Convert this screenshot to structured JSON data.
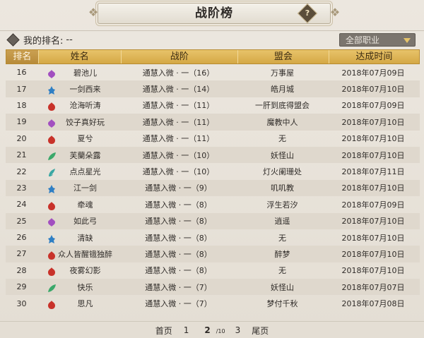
{
  "title": "战阶榜",
  "help_icon_glyph": "?",
  "my_rank": {
    "label": "我的排名:",
    "value": "--"
  },
  "job_filter": {
    "selected": "全部职业"
  },
  "table": {
    "headers": [
      "排名",
      "姓名",
      "战阶",
      "盟会",
      "达成时间"
    ],
    "rows": [
      {
        "rank": "16",
        "name": "碧池儿",
        "icon": "purple-lotus-icon",
        "tier": "通慧入微 · 一（16）",
        "guild": "万事屋",
        "date": "2018年07月09日"
      },
      {
        "rank": "17",
        "name": "一剑西来",
        "icon": "blue-lamp-icon",
        "tier": "通慧入微 · 一（14）",
        "guild": "皓月城",
        "date": "2018年07月10日"
      },
      {
        "rank": "18",
        "name": "沧海听涛",
        "icon": "red-flame-icon",
        "tier": "通慧入微 · 一（11）",
        "guild": "一肝到底得盟会",
        "date": "2018年07月09日"
      },
      {
        "rank": "19",
        "name": "饺子真好玩",
        "icon": "purple-lotus-icon",
        "tier": "通慧入微 · 一（11）",
        "guild": "魔教中人",
        "date": "2018年07月10日"
      },
      {
        "rank": "20",
        "name": "夏兮",
        "icon": "red-flame-icon",
        "tier": "通慧入微 · 一（11）",
        "guild": "无",
        "date": "2018年07月10日"
      },
      {
        "rank": "21",
        "name": "芙蘭朵露",
        "icon": "green-leaf-icon",
        "tier": "通慧入微 · 一（10）",
        "guild": "妖怪山",
        "date": "2018年07月10日"
      },
      {
        "rank": "22",
        "name": "点点星光",
        "icon": "teal-feather-icon",
        "tier": "通慧入微 · 一（10）",
        "guild": "灯火阑珊处",
        "date": "2018年07月11日"
      },
      {
        "rank": "23",
        "name": "江一剑",
        "icon": "blue-lamp-icon",
        "tier": "通慧入微 · 一（9）",
        "guild": "叽叽教",
        "date": "2018年07月10日"
      },
      {
        "rank": "24",
        "name": "牵魂",
        "icon": "red-flame-icon",
        "tier": "通慧入微 · 一（8）",
        "guild": "浮生若汐",
        "date": "2018年07月09日"
      },
      {
        "rank": "25",
        "name": "如此弓",
        "icon": "purple-lotus-icon",
        "tier": "通慧入微 · 一（8）",
        "guild": "逍遥",
        "date": "2018年07月10日"
      },
      {
        "rank": "26",
        "name": "清缺",
        "icon": "blue-lamp-icon",
        "tier": "通慧入微 · 一（8）",
        "guild": "无",
        "date": "2018年07月10日"
      },
      {
        "rank": "27",
        "name": "众人皆醒锇独醉",
        "icon": "red-flame-icon",
        "tier": "通慧入微 · 一（8）",
        "guild": "醉梦",
        "date": "2018年07月10日"
      },
      {
        "rank": "28",
        "name": "夜雾幻影",
        "icon": "red-flame-icon",
        "tier": "通慧入微 · 一（8）",
        "guild": "无",
        "date": "2018年07月10日"
      },
      {
        "rank": "29",
        "name": "快乐",
        "icon": "green-leaf-icon",
        "tier": "通慧入微 · 一（7）",
        "guild": "妖怪山",
        "date": "2018年07月07日"
      },
      {
        "rank": "30",
        "name": "思凡",
        "icon": "red-flame-icon",
        "tier": "通慧入微 · 一（7）",
        "guild": "梦付千秋",
        "date": "2018年07月08日"
      }
    ]
  },
  "pagination": {
    "first": "首页",
    "prev_page": "1",
    "current": "2",
    "total": "/10",
    "next_page": "3",
    "last": "尾页"
  },
  "icon_colors": {
    "purple-lotus-icon": "#a24fc0",
    "blue-lamp-icon": "#2f7fc4",
    "red-flame-icon": "#c8322a",
    "green-leaf-icon": "#3aa86a",
    "teal-feather-icon": "#3aa7a3"
  }
}
